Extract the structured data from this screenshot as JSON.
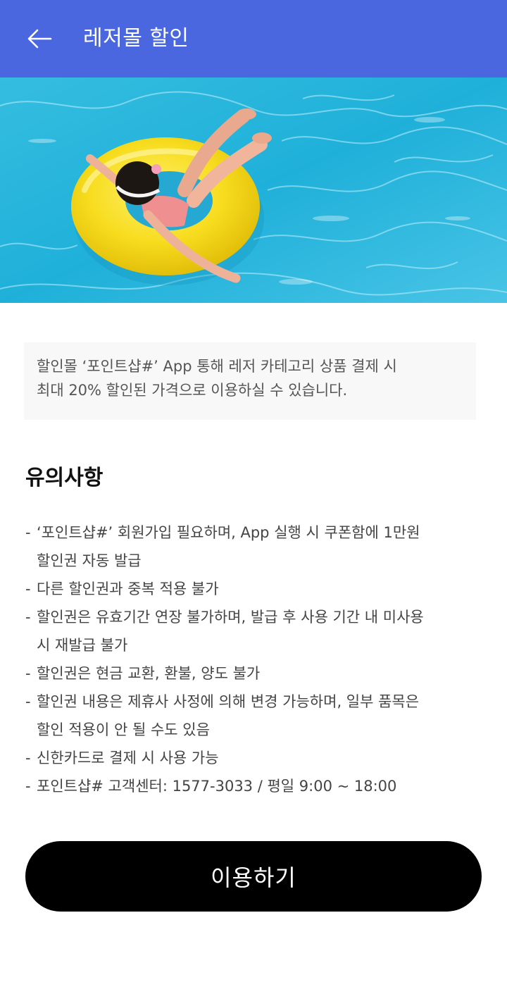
{
  "header": {
    "title": "레저몰 할인",
    "back_icon": "arrow-left-icon",
    "background": "#4a67e0"
  },
  "hero": {
    "image_icon": "child-in-yellow-swim-ring-pool-image"
  },
  "notice": {
    "text": "할인몰 ‘포인트샵#’ App 통해 레저 카테고리 상품 결제 시\n최대 20% 할인된 가격으로 이용하실 수 있습니다."
  },
  "cautions": {
    "title": "유의사항",
    "items": [
      {
        "bullet": "-",
        "text": " ‘포인트샵#’ 회원가입 필요하며, App 실행 시 쿠폰함에 1만원\n할인권 자동 발급"
      },
      {
        "bullet": "-",
        "text": "다른 할인권과 중복 적용 불가"
      },
      {
        "bullet": "-",
        "text": "할인권은 유효기간 연장 불가하며, 발급 후 사용 기간 내 미사용\n시 재발급 불가"
      },
      {
        "bullet": "-",
        "text": "할인권은 현금 교환, 환불, 양도 불가"
      },
      {
        "bullet": "-",
        "text": "할인권 내용은 제휴사 사정에 의해 변경 가능하며, 일부 품목은\n할인 적용이 안 될 수도 있음"
      },
      {
        "bullet": "-",
        "text": "신한카드로 결제 시 사용 가능"
      },
      {
        "bullet": "-",
        "text": "포인트샵# 고객센터: 1577-3033 / 평일 9:00 ~ 18:00"
      }
    ]
  },
  "cta": {
    "label": "이용하기"
  }
}
